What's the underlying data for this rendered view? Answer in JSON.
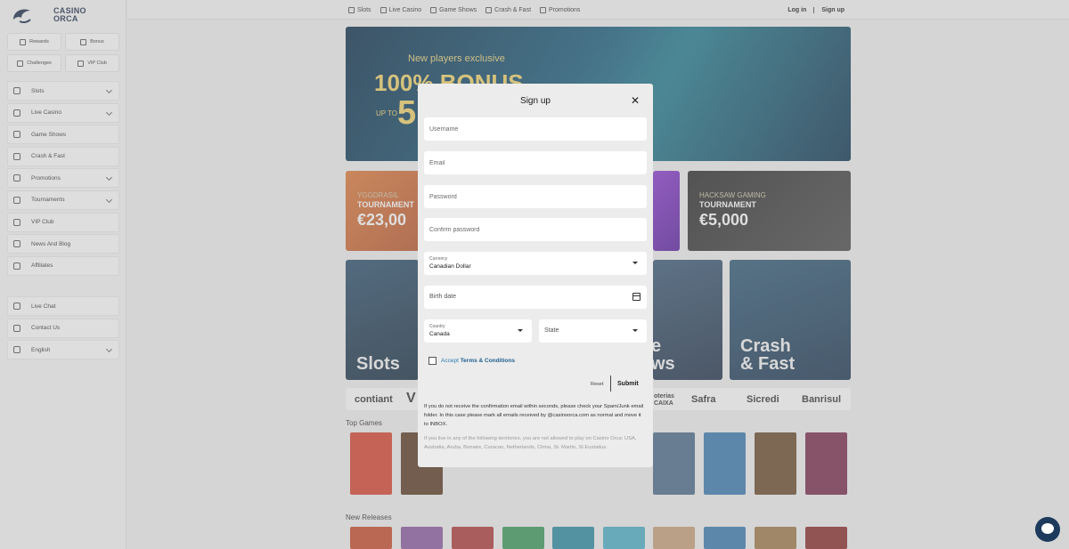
{
  "brand": {
    "name_line1": "CASINO",
    "name_line2": "ORCA"
  },
  "quick_links": [
    {
      "label": "Rewards",
      "icon": "gift-icon"
    },
    {
      "label": "Bonus",
      "icon": "bonus-icon"
    },
    {
      "label": "Challenges",
      "icon": "challenge-icon"
    },
    {
      "label": "VIP Club",
      "icon": "crown-icon"
    }
  ],
  "sidebar": {
    "items": [
      {
        "label": "Slots",
        "has_chevron": true
      },
      {
        "label": "Live Casino",
        "has_chevron": true
      },
      {
        "label": "Game Shows",
        "has_chevron": false
      },
      {
        "label": "Crash & Fast",
        "has_chevron": false
      },
      {
        "label": "Promotions",
        "has_chevron": true
      },
      {
        "label": "Tournaments",
        "has_chevron": true
      },
      {
        "label": "VIP Club",
        "has_chevron": false
      },
      {
        "label": "News And Blog",
        "has_chevron": false
      },
      {
        "label": "Affiliates",
        "has_chevron": false
      }
    ],
    "secondary": [
      {
        "label": "Live Chat"
      },
      {
        "label": "Contact Us"
      },
      {
        "label": "English"
      }
    ]
  },
  "topnav": [
    "Slots",
    "Live Casino",
    "Game Shows",
    "Crash & Fast",
    "Promotions"
  ],
  "auth": {
    "login": "Log in",
    "signup": "Sign up"
  },
  "hero": {
    "line1": "New players exclusive",
    "line2": "100% BONUS",
    "line3": "UP TO",
    "line4": "5"
  },
  "promos": [
    {
      "small": "YGGDRASIL",
      "mid": "TOURNAMENT",
      "big": "€23,00"
    },
    {
      "small": "HACKSAW GAMING",
      "mid": "TOURNAMENT",
      "big": "€5,000"
    }
  ],
  "categories": [
    {
      "label": "Slots"
    },
    {
      "label": "e\nws"
    },
    {
      "label": "Crash\n& Fast"
    }
  ],
  "payments": [
    "contiant",
    "V",
    "oterias CAIXA",
    "Safra",
    "Sicredi",
    "Banrisul"
  ],
  "sections": {
    "top_games": "Top Games",
    "new_releases": "New Releases"
  },
  "modal": {
    "title": "Sign up",
    "username_placeholder": "Username",
    "email_placeholder": "Email",
    "password_placeholder": "Password",
    "confirm_password_placeholder": "Confirm password",
    "currency_label": "Currency",
    "currency_value": "Canadian Dollar",
    "birthdate_placeholder": "Birth date",
    "country_label": "Country",
    "country_value": "Canada",
    "state_placeholder": "State",
    "accept_text": "Accept",
    "terms_link": "Terms & Conditions",
    "reset_label": "Reset",
    "submit_label": "Submit",
    "note_confirm": "If you do not receive the confirmation email within seconds, please check your Spam/Junk email folder. In this case please mark all emails received by @casinoorca.com as normal and move it to INBOX.",
    "note_territories": "If you live in any of the following territories, you are not allowed to play on Casino Orca: USA, Australia, Aruba, Bonaire, Curacao, Netherlands, China, St. Martin, St Eustatius."
  },
  "colors": {
    "brand_navy": "#1d3a5c",
    "link_blue": "#2a7bb5",
    "modal_bg": "#ececec"
  }
}
